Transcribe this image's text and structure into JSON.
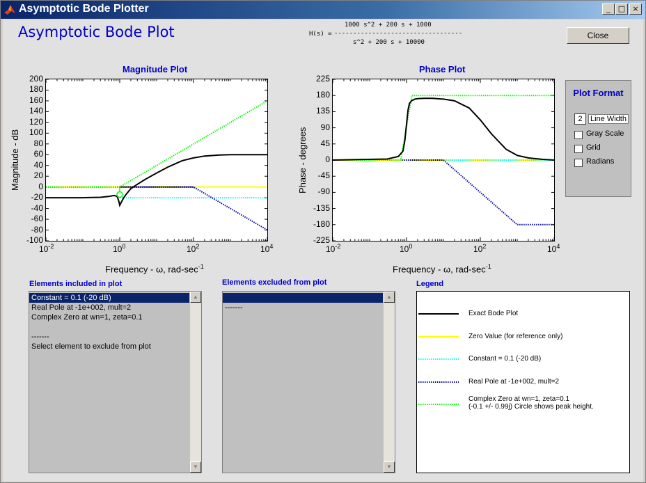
{
  "window": {
    "title": "Asymptotic Bode Plotter"
  },
  "header": {
    "page_title": "Asymptotic Bode Plot",
    "close_label": "Close"
  },
  "transfer_function": {
    "lhs": "H(s) = ",
    "numerator": "1000 s^2 + 200 s + 1000",
    "bar": "----------------------------------",
    "denominator": "s^2 + 200 s + 10000"
  },
  "magnitude_plot": {
    "title": "Magnitude Plot",
    "ylabel": "Magnitude - dB",
    "xlabel": "Frequency - ω, rad-sec",
    "yticks": [
      "200",
      "180",
      "160",
      "140",
      "120",
      "100",
      "80",
      "60",
      "40",
      "20",
      "0",
      "-20",
      "-40",
      "-60",
      "-80",
      "-100"
    ],
    "xticks": [
      {
        "base": "10",
        "exp": "-2"
      },
      {
        "base": "10",
        "exp": "0"
      },
      {
        "base": "10",
        "exp": "2"
      },
      {
        "base": "10",
        "exp": "4"
      }
    ]
  },
  "phase_plot": {
    "title": "Phase Plot",
    "ylabel": "Phase - degrees",
    "xlabel": "Frequency - ω, rad-sec",
    "yticks": [
      "225",
      "180",
      "135",
      "90",
      "45",
      "0",
      "-45",
      "-90",
      "-135",
      "-180",
      "-225"
    ],
    "xticks": [
      {
        "base": "10",
        "exp": "-2"
      },
      {
        "base": "10",
        "exp": "0"
      },
      {
        "base": "10",
        "exp": "2"
      },
      {
        "base": "10",
        "exp": "4"
      }
    ]
  },
  "xlabel_superscript": "-1",
  "plot_format": {
    "title": "Plot Format",
    "line_width_value": "2",
    "line_width_label": "Line Width",
    "gray_scale": "Gray Scale",
    "grid": "Grid",
    "radians": "Radians"
  },
  "included": {
    "title": "Elements included in plot",
    "items": [
      "Constant = 0.1 (-20 dB)",
      "Real Pole at -1e+002, mult=2",
      "Complex Zero at wn=1, zeta=0.1",
      "",
      "-------",
      "Select element to exclude from plot"
    ]
  },
  "excluded": {
    "title": "Elements excluded from plot",
    "items": [
      "",
      "-------"
    ]
  },
  "legend": {
    "title": "Legend",
    "items": [
      {
        "text": "Exact Bode Plot",
        "color": "#000000",
        "dotted": false
      },
      {
        "text": "Zero Value (for reference only)",
        "color": "#ffff00",
        "dotted": false
      },
      {
        "text": "Constant = 0.1 (-20 dB)",
        "color": "#00ffff",
        "dotted": true
      },
      {
        "text": "Real Pole at -1e+002, mult=2",
        "color": "#0000b0",
        "dotted": true
      },
      {
        "text": "Complex Zero at wn=1, zeta=0.1",
        "text2": "(-0.1 +/- 0.99j)  Circle shows peak height.",
        "color": "#00ff00",
        "dotted": true
      }
    ]
  },
  "colors": {
    "exact": "#000000",
    "zero": "#ffff00",
    "constant": "#00ffff",
    "pole": "#0000b0",
    "zero_complex": "#00ff00",
    "title_blue": "#0000c8"
  },
  "chart_data": [
    {
      "type": "line",
      "title": "Magnitude Plot",
      "xlabel": "Frequency - ω, rad-sec-1",
      "ylabel": "Magnitude - dB",
      "xscale": "log",
      "xlim": [
        0.01,
        10000
      ],
      "ylim": [
        -100,
        200
      ],
      "series": [
        {
          "name": "Exact Bode Plot",
          "color": "#000000",
          "x": [
            0.01,
            0.1,
            0.3,
            0.5,
            0.7,
            0.85,
            0.95,
            1,
            1.1,
            1.3,
            1.6,
            2,
            3,
            5,
            10,
            20,
            50,
            100,
            200,
            500,
            1000,
            10000
          ],
          "y": [
            -20,
            -20,
            -19.2,
            -17.6,
            -15.8,
            -17.5,
            -27,
            -34,
            -28.5,
            -19.5,
            -11,
            -3,
            5,
            14.5,
            26,
            37,
            49,
            54,
            57.5,
            59.5,
            60,
            60
          ]
        },
        {
          "name": "Zero Value (for reference only)",
          "color": "#ffff00",
          "x": [
            0.01,
            10000
          ],
          "y": [
            0,
            0
          ]
        },
        {
          "name": "Constant = 0.1 (-20 dB)",
          "color": "#00ffff",
          "x": [
            1,
            10000
          ],
          "y": [
            -20,
            -20
          ]
        },
        {
          "name": "Real Pole at -1e+002, mult=2",
          "color": "#0000b0",
          "x": [
            0.01,
            100,
            10000
          ],
          "y": [
            0,
            0,
            -80
          ]
        },
        {
          "name": "Complex Zero at wn=1, zeta=0.1",
          "color": "#00ff00",
          "x": [
            0.01,
            1,
            10000
          ],
          "y": [
            0,
            0,
            160
          ]
        }
      ],
      "markers": [
        {
          "x": 1,
          "y": -14,
          "shape": "circle",
          "color": "#00ff00"
        }
      ]
    },
    {
      "type": "line",
      "title": "Phase Plot",
      "xlabel": "Frequency - ω, rad-sec-1",
      "ylabel": "Phase - degrees",
      "xscale": "log",
      "xlim": [
        0.01,
        10000
      ],
      "ylim": [
        -225,
        225
      ],
      "series": [
        {
          "name": "Exact Bode Plot",
          "color": "#000000",
          "x": [
            0.01,
            0.3,
            0.6,
            0.8,
            0.9,
            1,
            1.1,
            1.2,
            1.4,
            1.7,
            2,
            3,
            5,
            10,
            20,
            50,
            100,
            200,
            500,
            1000,
            2000,
            5000,
            10000
          ],
          "y": [
            0,
            3,
            10,
            25,
            55,
            100,
            140,
            158,
            166,
            170,
            171,
            172,
            172,
            170,
            165,
            145,
            112,
            73,
            30,
            13,
            6,
            2,
            0
          ]
        },
        {
          "name": "Zero Value (for reference only)",
          "color": "#ffff00",
          "x": [
            0.01,
            10000
          ],
          "y": [
            0,
            0
          ]
        },
        {
          "name": "Constant = 0.1 (-20 dB)",
          "color": "#00ffff",
          "x": [
            0.01,
            10000
          ],
          "y": [
            0,
            0
          ]
        },
        {
          "name": "Real Pole at -1e+002, mult=2",
          "color": "#0000b0",
          "x": [
            0.01,
            10,
            1000,
            10000
          ],
          "y": [
            0,
            0,
            -180,
            -180
          ]
        },
        {
          "name": "Complex Zero at wn=1, zeta=0.1",
          "color": "#00ff00",
          "x": [
            0.01,
            0.7,
            1.4,
            10000
          ],
          "y": [
            0,
            0,
            180,
            180
          ]
        }
      ]
    }
  ]
}
